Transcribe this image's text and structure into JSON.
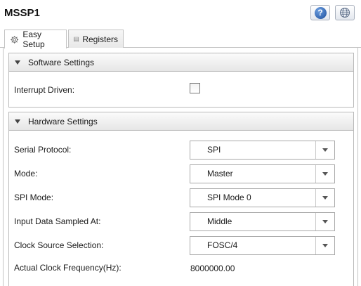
{
  "window": {
    "title": "MSSP1"
  },
  "toolbar": {
    "help_icon": "question-icon",
    "help_glyph": "?",
    "globe_icon": "globe-icon"
  },
  "tabs": [
    {
      "label": "Easy Setup",
      "icon": "gear-icon",
      "active": true
    },
    {
      "label": "Registers",
      "icon": "table-icon",
      "active": false
    }
  ],
  "software_settings": {
    "header": "Software Settings",
    "interrupt_driven": {
      "label": "Interrupt Driven:",
      "checked": false
    }
  },
  "hardware_settings": {
    "header": "Hardware Settings",
    "fields": [
      {
        "label": "Serial Protocol:",
        "value": "SPI"
      },
      {
        "label": "Mode:",
        "value": "Master"
      },
      {
        "label": "SPI Mode:",
        "value": "SPI Mode 0"
      },
      {
        "label": "Input Data Sampled At:",
        "value": "Middle"
      },
      {
        "label": "Clock Source Selection:",
        "value": "FOSC/4"
      }
    ],
    "clock_frequency": {
      "label": "Actual Clock Frequency(Hz):",
      "value": "8000000.00"
    }
  }
}
